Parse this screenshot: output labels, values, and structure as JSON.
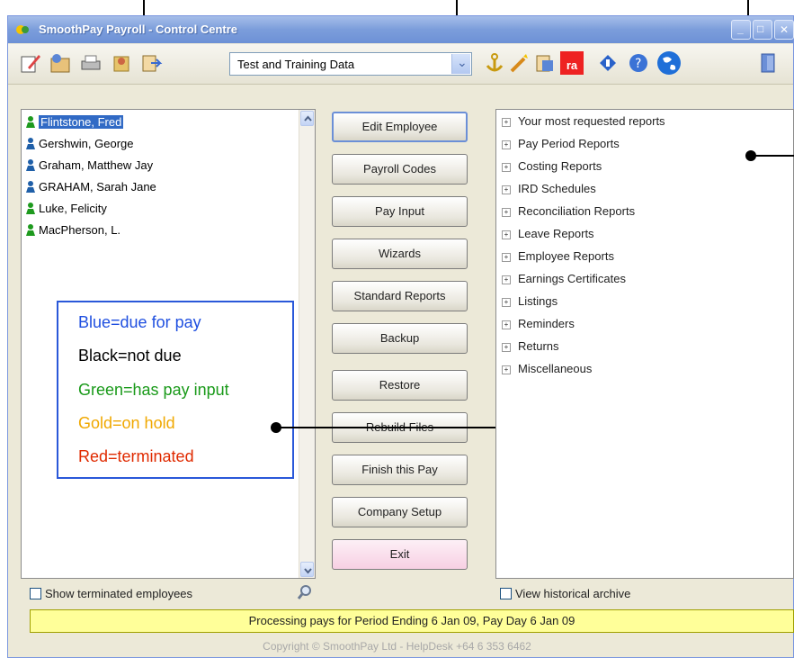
{
  "window": {
    "title": "SmoothPay Payroll - Control Centre",
    "min_glyph": "_",
    "max_glyph": "□",
    "close_glyph": "✕"
  },
  "toolbar": {
    "dataset_selected": "Test and Training Data",
    "dropdown_glyph": "⌄",
    "ra_label": "ra",
    "icons": [
      "edit-icon",
      "setup-icon",
      "print-icon",
      "users-icon",
      "export-icon",
      "anchor-icon",
      "wand-icon",
      "archive-icon",
      "ra-icon",
      "info-icon",
      "help-icon",
      "globe-icon",
      "exit-door-icon"
    ]
  },
  "employees": [
    {
      "name": "Flintstone, Fred",
      "color": "#1e9a1e",
      "selected": true
    },
    {
      "name": "Gershwin, George",
      "color": "#1f5fa8"
    },
    {
      "name": "Graham, Matthew Jay",
      "color": "#1f5fa8"
    },
    {
      "name": "GRAHAM, Sarah Jane",
      "color": "#1f5fa8"
    },
    {
      "name": "Luke, Felicity",
      "color": "#1e9a1e"
    },
    {
      "name": "MacPherson, L.",
      "color": "#1e9a1e"
    }
  ],
  "legend": {
    "blue": "Blue=due for pay",
    "black": "Black=not due",
    "green": "Green=has pay input",
    "gold": "Gold=on hold",
    "red": "Red=terminated",
    "colors": {
      "blue": "#1f4fe0",
      "black": "#000000",
      "green": "#1a9a1a",
      "gold": "#f0a800",
      "red": "#e02a00"
    }
  },
  "buttons": [
    "Edit Employee",
    "Payroll Codes",
    "Pay Input",
    "Wizards",
    "Standard Reports",
    "Backup",
    "Restore",
    "Rebuild Files",
    "Finish this Pay",
    "Company Setup",
    "Exit"
  ],
  "reports": {
    "expand_glyph": "+",
    "items": [
      "Your most requested reports",
      "Pay Period Reports",
      "Costing Reports",
      "IRD Schedules",
      "Reconciliation Reports",
      "Leave Reports",
      "Employee Reports",
      "Earnings Certificates",
      "Listings",
      "Reminders",
      "Returns",
      "Miscellaneous"
    ]
  },
  "options": {
    "show_terminated": "Show terminated employees",
    "view_archive": "View historical archive"
  },
  "status": {
    "text": "Processing pays for Period Ending 6 Jan 09, Pay Day 6 Jan 09",
    "copyright": "Copyright © SmoothPay Ltd - HelpDesk +64 6 353 6462"
  }
}
